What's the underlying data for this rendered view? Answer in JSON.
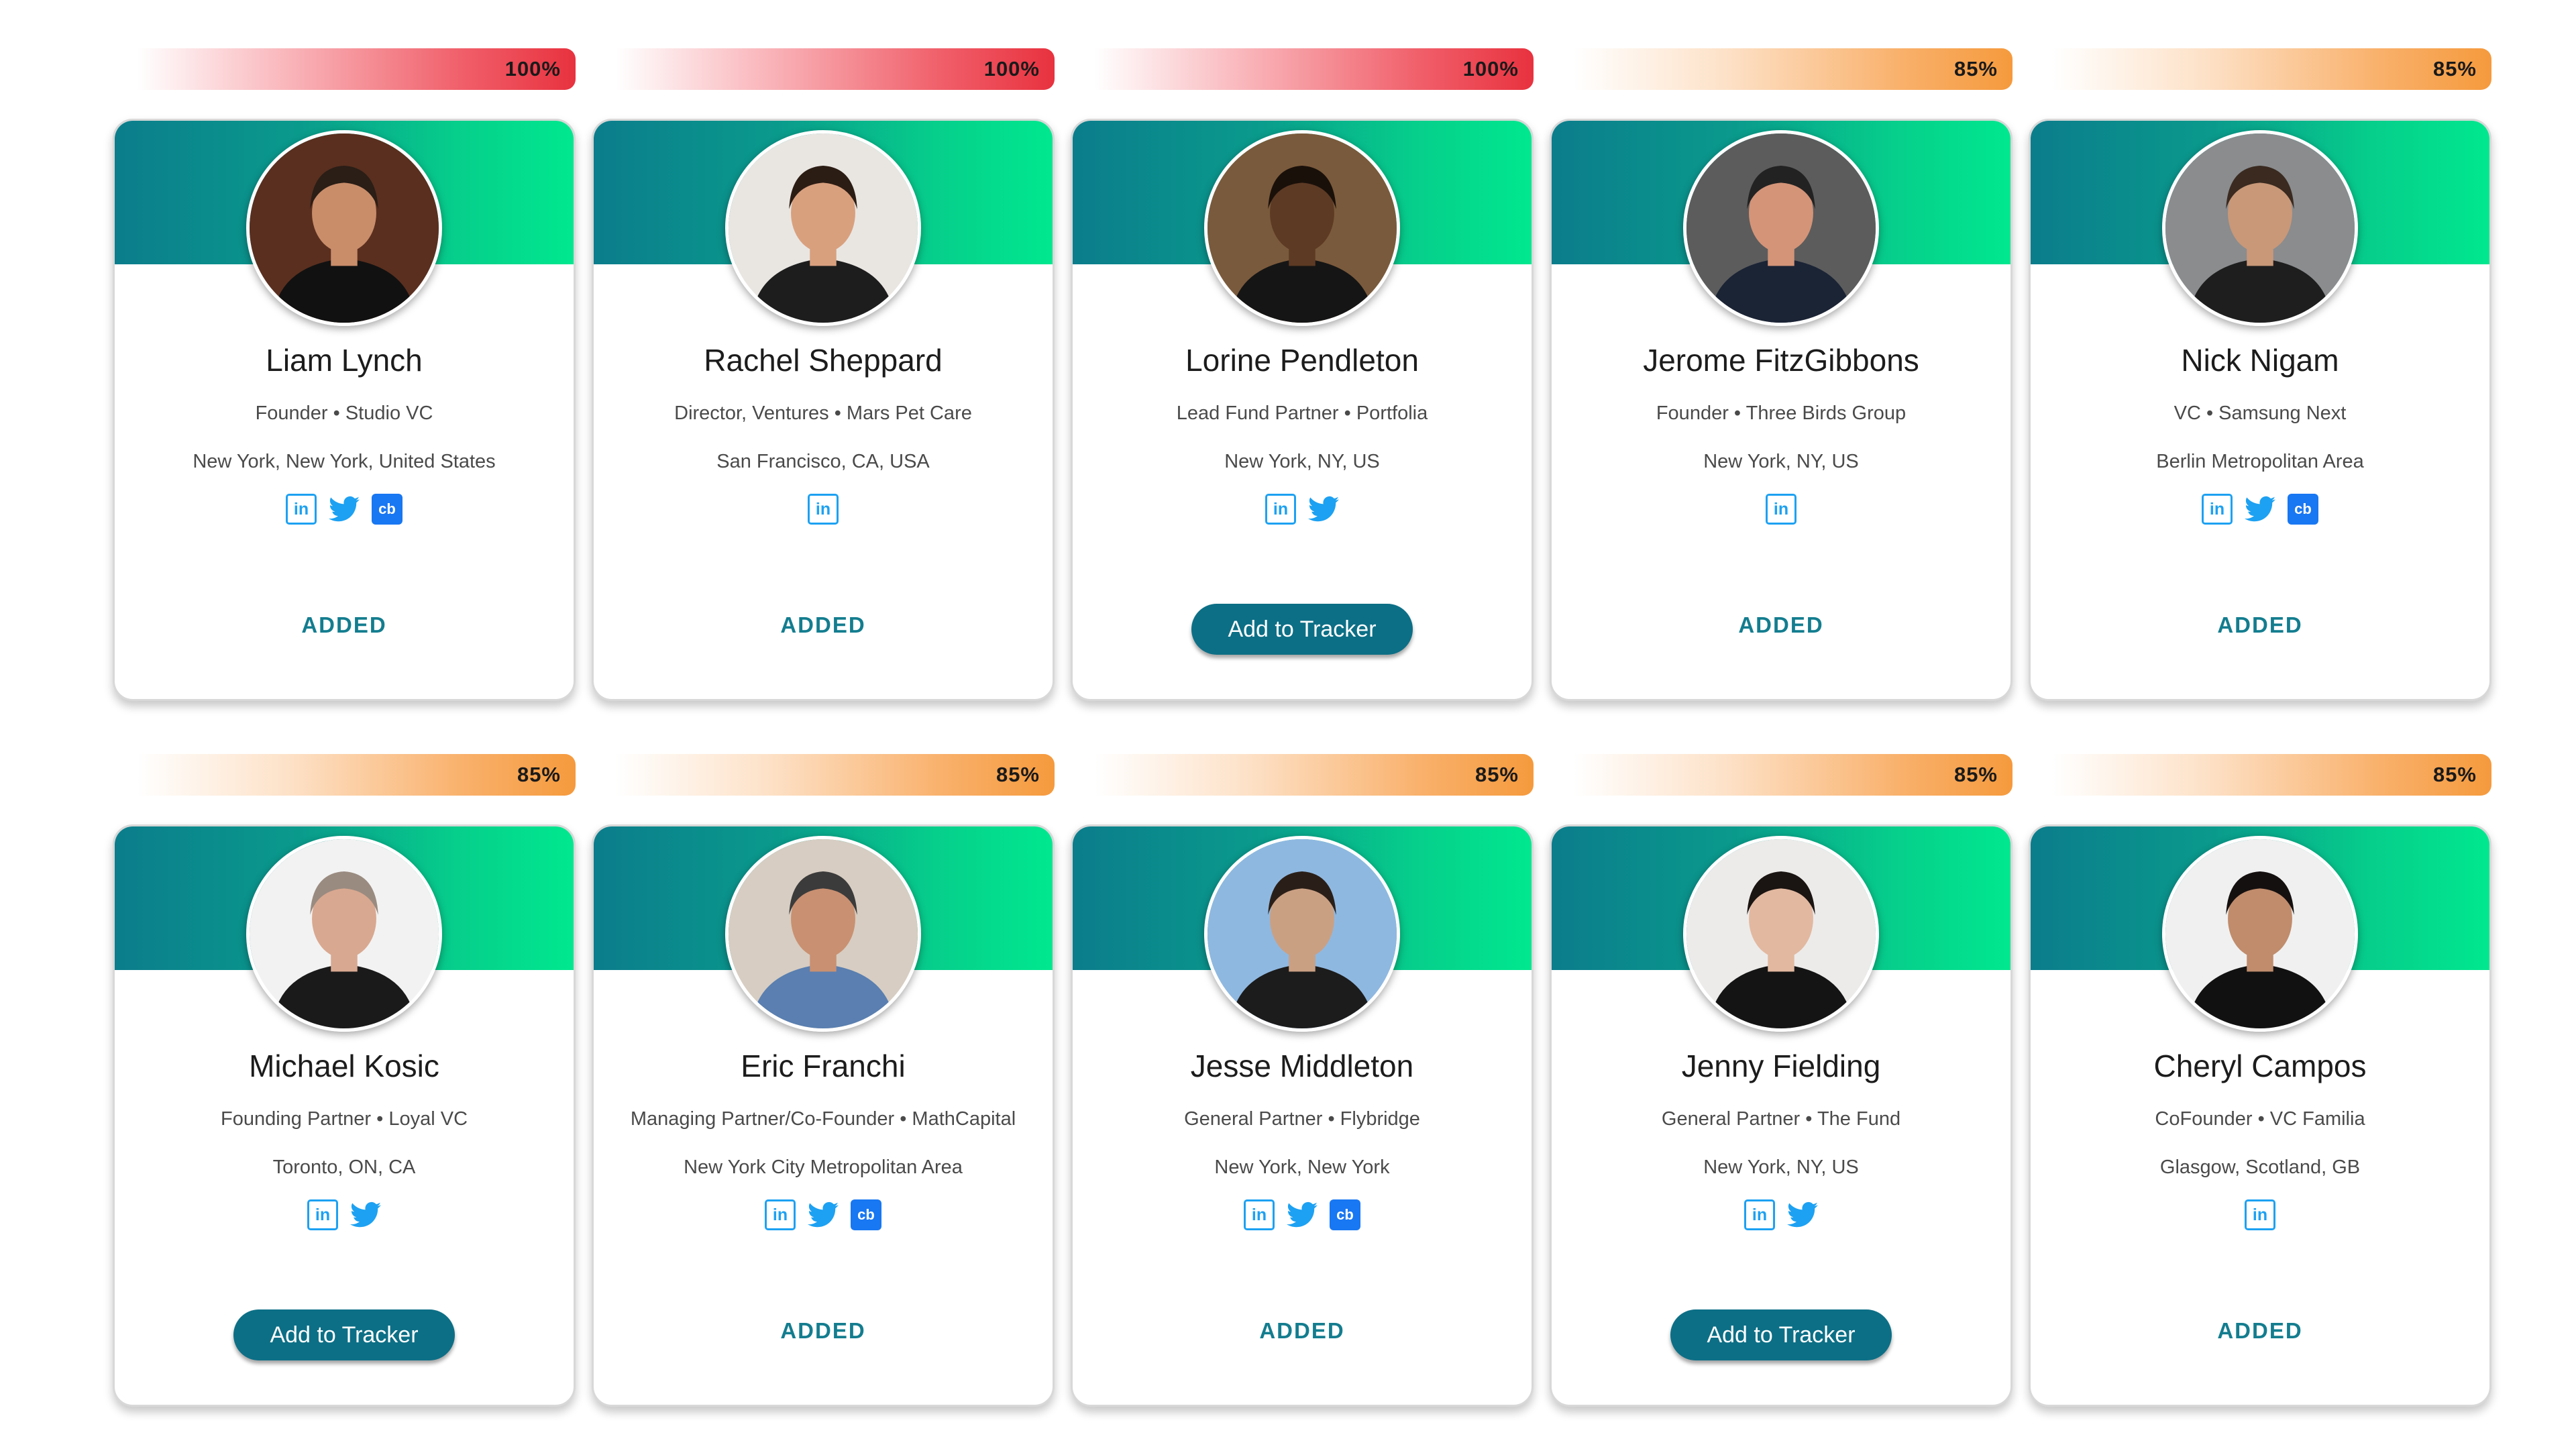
{
  "cards": [
    {
      "match": "100%",
      "level": "red",
      "name": "Liam Lynch",
      "role": "Founder • Studio VC",
      "location": "New York, New York, United States",
      "linkedin": "in",
      "twitter": true,
      "crunchbase": "cb",
      "status": "ADDED",
      "skin": "#c98d6a",
      "hair": "#2a1e16",
      "bg": "#5a2f1f",
      "shirt": "#111111"
    },
    {
      "match": "100%",
      "level": "red",
      "name": "Rachel Sheppard",
      "role": "Director, Ventures • Mars Pet Care",
      "location": "San Francisco, CA, USA",
      "linkedin": "in",
      "twitter": false,
      "crunchbase": "",
      "status": "ADDED",
      "skin": "#d9a07e",
      "hair": "#2c1d14",
      "bg": "#e9e6e2",
      "shirt": "#1d1d1d"
    },
    {
      "match": "100%",
      "level": "red",
      "name": "Lorine Pendleton",
      "role": "Lead Fund Partner • Portfolia",
      "location": "New York, NY, US",
      "linkedin": "in",
      "twitter": true,
      "crunchbase": "",
      "status": "",
      "button": "Add to Tracker",
      "skin": "#5d3a24",
      "hair": "#1a100a",
      "bg": "#7a5a3c",
      "shirt": "#151515"
    },
    {
      "match": "85%",
      "level": "orange",
      "name": "Jerome FitzGibbons",
      "role": "Founder • Three Birds Group",
      "location": "New York, NY, US",
      "linkedin": "in",
      "twitter": false,
      "crunchbase": "",
      "status": "ADDED",
      "skin": "#d49478",
      "hair": "#222222",
      "bg": "#5c5c5c",
      "shirt": "#1b2435"
    },
    {
      "match": "85%",
      "level": "orange",
      "name": "Nick Nigam",
      "role": "VC • Samsung Next",
      "location": "Berlin Metropolitan Area",
      "linkedin": "in",
      "twitter": true,
      "crunchbase": "cb",
      "status": "ADDED",
      "skin": "#c89878",
      "hair": "#3a2a20",
      "bg": "#8a8c8e",
      "shirt": "#1e1e1e"
    },
    {
      "match": "85%",
      "level": "orange",
      "name": "Michael Kosic",
      "role": "Founding Partner • Loyal VC",
      "location": "Toronto, ON, CA",
      "linkedin": "in",
      "twitter": true,
      "crunchbase": "",
      "status": "",
      "button": "Add to Tracker",
      "skin": "#d9a890",
      "hair": "#9a8b80",
      "bg": "#f2f2f2",
      "shirt": "#1a1a1a"
    },
    {
      "match": "85%",
      "level": "orange",
      "name": "Eric Franchi",
      "role": "Managing Partner/Co-Founder • MathCapital",
      "location": "New York City Metropolitan Area",
      "linkedin": "in",
      "twitter": true,
      "crunchbase": "cb",
      "status": "ADDED",
      "skin": "#c99071",
      "hair": "#3b3b3b",
      "bg": "#d7cdc2",
      "shirt": "#5a7fb0"
    },
    {
      "match": "85%",
      "level": "orange",
      "name": "Jesse Middleton",
      "role": "General Partner • Flybridge",
      "location": "New York, New York",
      "linkedin": "in",
      "twitter": true,
      "crunchbase": "cb",
      "status": "ADDED",
      "skin": "#caa083",
      "hair": "#2a1f18",
      "bg": "#8fb8e0",
      "shirt": "#1c1c1c"
    },
    {
      "match": "85%",
      "level": "orange",
      "name": "Jenny Fielding",
      "role": "General Partner • The Fund",
      "location": "New York, NY, US",
      "linkedin": "in",
      "twitter": true,
      "crunchbase": "",
      "status": "",
      "button": "Add to Tracker",
      "skin": "#e2b8a0",
      "hair": "#1a1412",
      "bg": "#ecebea",
      "shirt": "#141414"
    },
    {
      "match": "85%",
      "level": "orange",
      "name": "Cheryl Campos",
      "role": "CoFounder • VC Familia",
      "location": "Glasgow, Scotland, GB",
      "linkedin": "in",
      "twitter": false,
      "crunchbase": "",
      "status": "ADDED",
      "skin": "#c08c6c",
      "hair": "#151010",
      "bg": "#f0f0f0",
      "shirt": "#111111"
    }
  ]
}
